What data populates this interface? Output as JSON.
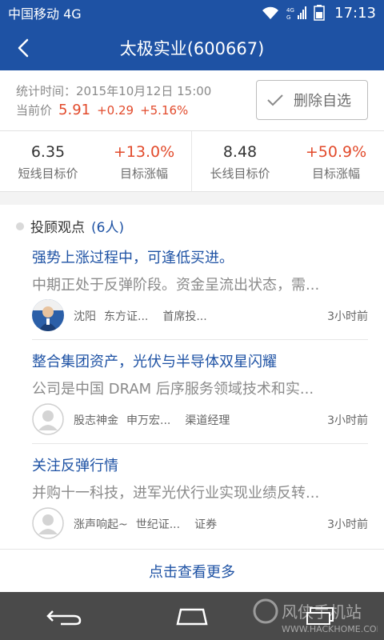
{
  "status_bar": {
    "carrier": "中国移动 4G",
    "time": "17:13",
    "icons": [
      "wifi-icon",
      "signal-icon",
      "battery-icon"
    ]
  },
  "header": {
    "title": "太极实业(600667)",
    "back_icon": "chevron-left-icon"
  },
  "info": {
    "stat_time": "统计时间：2015年10月12日 15:00",
    "price_label": "当前价",
    "price": "5.91",
    "change": "+0.29",
    "change_pct": "+5.16%",
    "remove_button_label": "删除自选",
    "remove_icon": "check-icon",
    "accent_color": "#1e52a4",
    "up_color": "#e24a2b"
  },
  "targets": [
    {
      "value": "6.35",
      "label": "短线目标价"
    },
    {
      "value": "+13.0%",
      "label": "目标涨幅"
    },
    {
      "value": "8.48",
      "label": "长线目标价"
    },
    {
      "value": "+50.9%",
      "label": "目标涨幅"
    }
  ],
  "opinions": {
    "title": "投顾观点",
    "count": "(6人)",
    "items": [
      {
        "title": "强势上涨过程中，可逢低买进。",
        "summary": "中期正处于反弹阶段。资金呈流出状态，需...",
        "author": "沈阳",
        "org": "东方证...",
        "role": "首席投...",
        "ago": "3小时前",
        "avatar": "photo-avatar"
      },
      {
        "title": "整合集团资产，光伏与半导体双星闪耀",
        "summary": "公司是中国 DRAM 后序服务领域技术和实...",
        "author": "股志神金",
        "org": "申万宏...",
        "role": "渠道经理",
        "ago": "3小时前",
        "avatar": "default-avatar-icon"
      },
      {
        "title": "关注反弹行情",
        "summary": "并购十一科技，进军光伏行业实现业绩反转...",
        "author": "涨声响起~",
        "org": "世纪证...",
        "role": "证券",
        "ago": "3小时前",
        "avatar": "default-avatar-icon"
      }
    ],
    "more_label": "点击查看更多"
  },
  "watermark": {
    "name": "风侠手机站",
    "url": "WWW.HACKHOME.COM"
  }
}
